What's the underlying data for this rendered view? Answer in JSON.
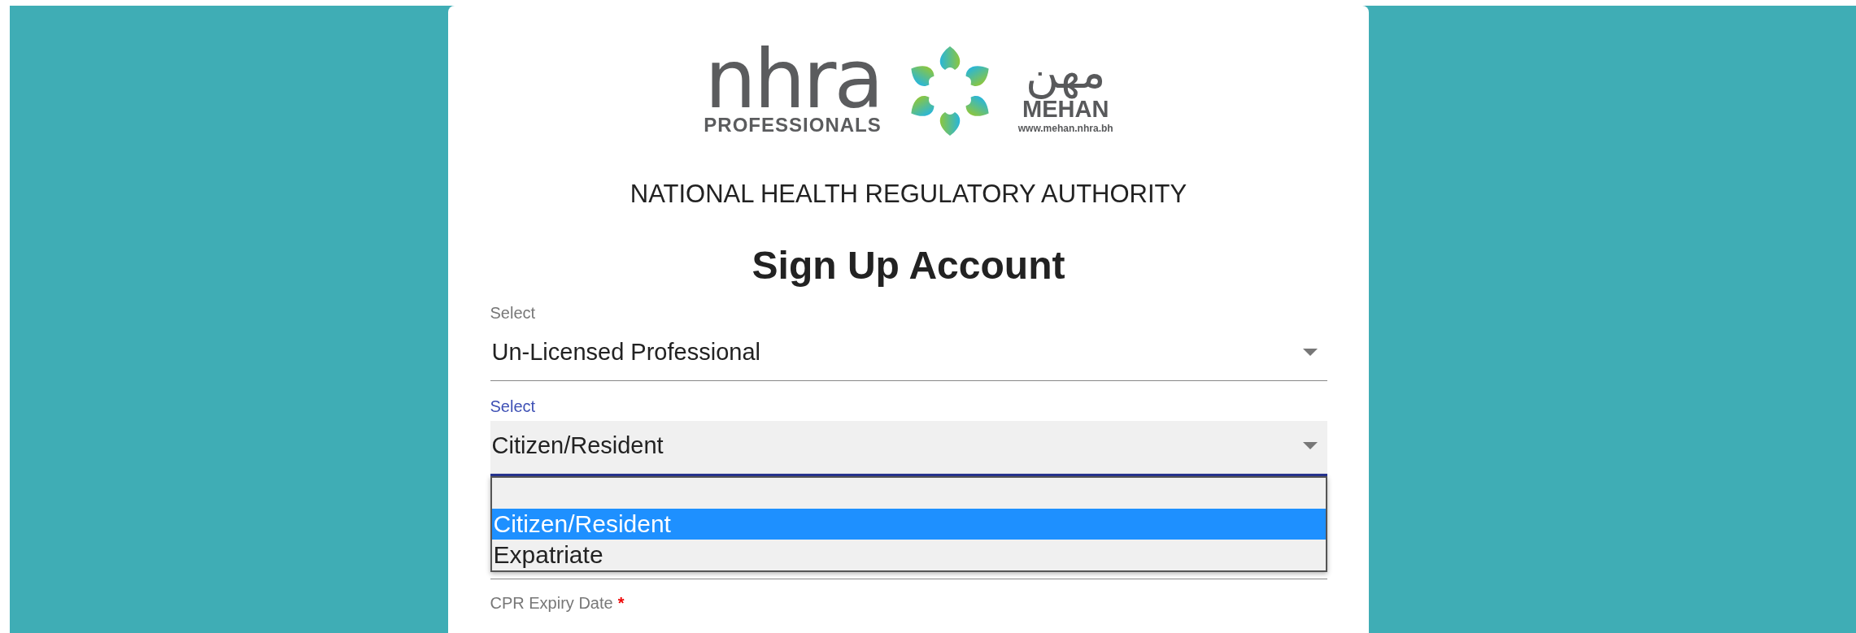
{
  "logo": {
    "wordmark": "nhra",
    "subtitle": "PROFESSIONALS",
    "arabic": "مهن",
    "brand": "MEHAN",
    "url": "www.mehan.nhra.bh"
  },
  "authority": "NATIONAL HEALTH REGULATORY AUTHORITY",
  "title": "Sign Up Account",
  "fields": [
    {
      "label": "Select",
      "value": "Un-Licensed Professional",
      "focused": false
    },
    {
      "label": "Select",
      "value": "Citizen/Resident",
      "focused": true
    }
  ],
  "dropdown": {
    "options": [
      {
        "label": "Citizen/Resident",
        "selected": true
      },
      {
        "label": "Expatriate",
        "selected": false
      }
    ]
  },
  "date_field": {
    "label": "CPR Expiry Date",
    "required": true,
    "required_mark": "*"
  }
}
